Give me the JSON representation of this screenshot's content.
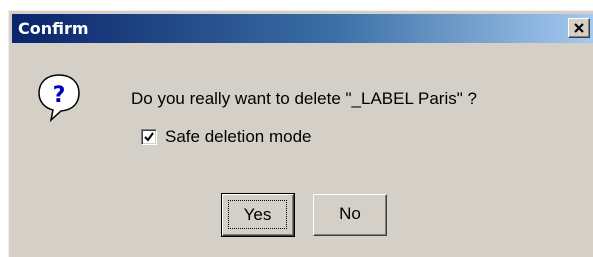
{
  "dialog": {
    "title": "Confirm",
    "close_symbol": "×",
    "icon": "question-icon",
    "message": "Do you really want to delete \"_LABEL Paris\" ?",
    "checkbox": {
      "label": "Safe deletion mode",
      "checked": true
    },
    "buttons": {
      "yes_label": "Yes",
      "no_label": "No"
    }
  },
  "colors": {
    "title_gradient_start": "#0a246a",
    "title_gradient_end": "#a6caf0",
    "window_bg": "#d4d0c8",
    "icon_bubble": "#ffffff",
    "icon_mark": "#0000c0"
  }
}
